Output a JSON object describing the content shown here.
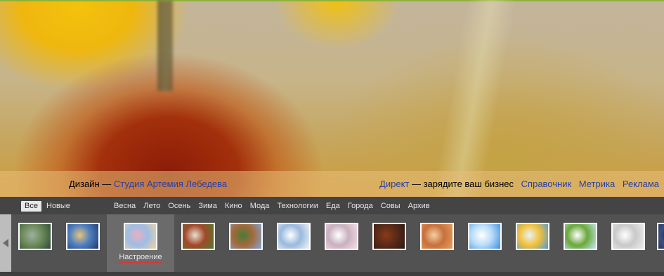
{
  "caption": {
    "design_prefix": "Дизайн — ",
    "design_link": "Студия Артемия Лебедева",
    "direct_link": "Директ",
    "direct_text": " — зарядите ваш бизнес",
    "links": [
      "Справочник",
      "Метрика",
      "Реклама"
    ]
  },
  "filters": [
    "Все",
    "Новые"
  ],
  "active_filter": "Все",
  "categories": [
    "Весна",
    "Лето",
    "Осень",
    "Зима",
    "Кино",
    "Мода",
    "Технологии",
    "Еда",
    "Города",
    "Совы",
    "Архив"
  ],
  "selected_theme_label": "Настроение",
  "thumbnails": [
    {
      "name": "theme-thumb-hulk",
      "colors": [
        "#2c4a3a",
        "#6d8a5a",
        "#9eb0a0"
      ]
    },
    {
      "name": "theme-thumb-cinderella",
      "colors": [
        "#1d3b6b",
        "#4f7fc0",
        "#e6c57a"
      ]
    },
    {
      "name": "theme-thumb-mood",
      "colors": [
        "#f0d3a0",
        "#9fbde6",
        "#e8b0c0"
      ]
    },
    {
      "name": "theme-thumb-game-1",
      "colors": [
        "#4f7b2a",
        "#a3482a",
        "#e8e0d0"
      ]
    },
    {
      "name": "theme-thumb-game-2",
      "colors": [
        "#80a5d8",
        "#a36a3a",
        "#4a7a3a"
      ]
    },
    {
      "name": "theme-thumb-ruler",
      "colors": [
        "#f4f4f4",
        "#9ab9dd",
        "#ffffff"
      ]
    },
    {
      "name": "theme-thumb-gears",
      "colors": [
        "#f4dfe6",
        "#c9b0bf",
        "#ffffff"
      ]
    },
    {
      "name": "theme-thumb-dark-room",
      "colors": [
        "#2a1a14",
        "#5a2a18",
        "#8a3a1a"
      ]
    },
    {
      "name": "theme-thumb-desert",
      "colors": [
        "#e3a060",
        "#c8703c",
        "#f3d0a0"
      ]
    },
    {
      "name": "theme-thumb-clouds",
      "colors": [
        "#3b8ee0",
        "#b8dcf8",
        "#ffffff"
      ]
    },
    {
      "name": "theme-thumb-bird",
      "colors": [
        "#4f9ad8",
        "#f3c13a",
        "#e7f3fb"
      ]
    },
    {
      "name": "theme-thumb-snowdrops",
      "colors": [
        "#c9e6f6",
        "#6aa83a",
        "#ffffff"
      ]
    },
    {
      "name": "theme-thumb-feathers",
      "colors": [
        "#ededed",
        "#c9c9c9",
        "#ffffff"
      ]
    },
    {
      "name": "theme-thumb-partial",
      "colors": [
        "#1e2c55",
        "#3c4f7c",
        "#101828"
      ]
    }
  ]
}
